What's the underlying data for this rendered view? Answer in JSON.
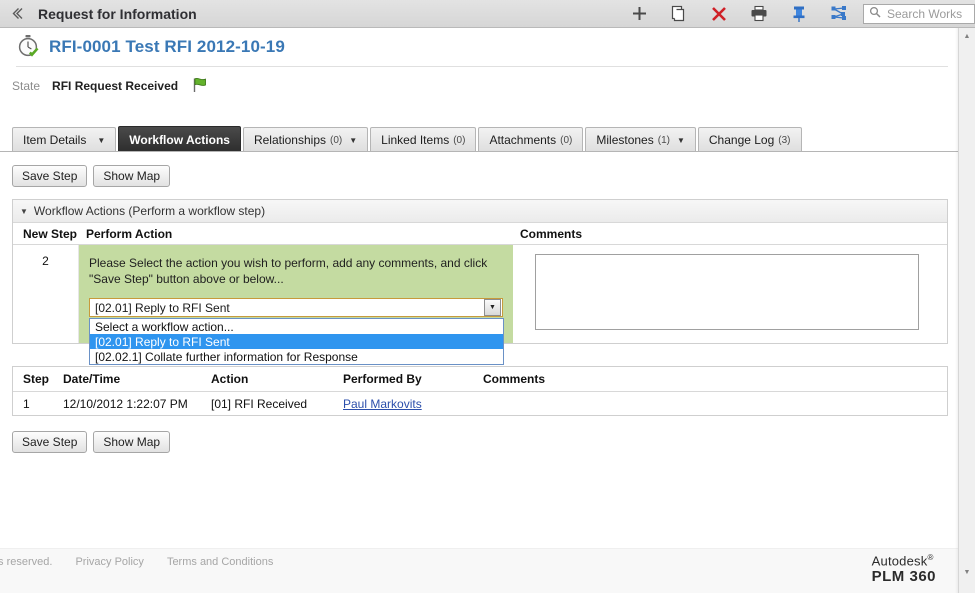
{
  "topbar": {
    "back_icon": "back-chevron-icon",
    "title": "Request for Information",
    "icons": [
      {
        "name": "add-icon",
        "glyph": "add"
      },
      {
        "name": "copy-icon",
        "glyph": "copy"
      },
      {
        "name": "delete-icon",
        "glyph": "delete"
      },
      {
        "name": "print-icon",
        "glyph": "print"
      },
      {
        "name": "pin-icon",
        "glyph": "pin"
      },
      {
        "name": "workflow-map-icon",
        "glyph": "network"
      }
    ],
    "search_placeholder": "Search Works",
    "search_value": ""
  },
  "header": {
    "item_title": "RFI-0001 Test RFI 2012-10-19",
    "state_label": "State",
    "state_value": "RFI Request Received"
  },
  "tabs": [
    {
      "label": "Item Details",
      "count": "",
      "caret": true,
      "active": false
    },
    {
      "label": "Workflow Actions",
      "count": "",
      "caret": false,
      "active": true
    },
    {
      "label": "Relationships",
      "count": "(0)",
      "caret": true,
      "active": false
    },
    {
      "label": "Linked Items",
      "count": "(0)",
      "caret": false,
      "active": false
    },
    {
      "label": "Attachments",
      "count": "(0)",
      "caret": false,
      "active": false
    },
    {
      "label": "Milestones",
      "count": "(1)",
      "caret": true,
      "active": false
    },
    {
      "label": "Change Log",
      "count": "(3)",
      "caret": false,
      "active": false
    }
  ],
  "toolbar": {
    "save_step_label": "Save Step",
    "show_map_label": "Show Map"
  },
  "panel": {
    "title": "Workflow Actions (Perform a workflow step)",
    "columns": {
      "new_step": "New Step",
      "perform_action": "Perform Action",
      "comments": "Comments"
    },
    "row": {
      "step_number": "2",
      "instruction": "Please Select the action you wish to perform, add any comments, and click \"Save Step\" button above or below...",
      "comments_value": ""
    },
    "action_select": {
      "value": "[02.01] Reply to RFI Sent",
      "open": true,
      "options": [
        {
          "label": "Select a workflow action...",
          "selected": false
        },
        {
          "label": "[02.01] Reply to RFI Sent",
          "selected": true
        },
        {
          "label": "[02.02.1] Collate further information for Response",
          "selected": false
        }
      ]
    }
  },
  "history": {
    "columns": [
      "Step",
      "Date/Time",
      "Action",
      "Performed By",
      "Comments"
    ],
    "rows": [
      {
        "step": "1",
        "datetime": "12/10/2012 1:22:07 PM",
        "action": "[01] RFI Received",
        "performed_by": "Paul Markovits",
        "comments": ""
      }
    ]
  },
  "footer": {
    "copyright": "ts reserved.",
    "privacy": "Privacy Policy",
    "terms": "Terms and Conditions",
    "brand_top": "Autodesk",
    "brand_reg": "®",
    "brand_bottom": "PLM 360"
  },
  "colors": {
    "accent_blue": "#3a78b5",
    "action_green": "#c4dba1",
    "highlight": "#2f95ef",
    "link": "#2b4eab"
  }
}
